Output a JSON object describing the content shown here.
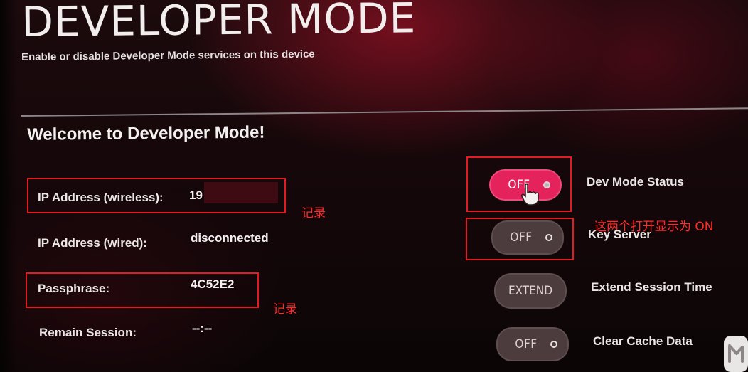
{
  "header": {
    "title": "DEVELOPER MODE",
    "subtitle": "Enable or disable Developer Mode services on this device"
  },
  "welcome": "Welcome to Developer Mode!",
  "info": {
    "ip_wireless": {
      "label": "IP Address (wireless):",
      "value": "19"
    },
    "ip_wired": {
      "label": "IP Address (wired):",
      "value": "disconnected"
    },
    "passphrase": {
      "label": "Passphrase:",
      "value": "4C52E2"
    },
    "remain_session": {
      "label": "Remain Session:",
      "value": "--:--"
    }
  },
  "toggles": {
    "dev_mode_status": {
      "label": "Dev Mode Status",
      "state": "OFF"
    },
    "key_server": {
      "label": "Key Server",
      "state": "OFF"
    },
    "extend_session": {
      "label": "Extend Session Time",
      "button": "EXTEND"
    },
    "clear_cache": {
      "label": "Clear Cache Data",
      "state": "OFF"
    }
  },
  "annotations": {
    "record_ip": "记录",
    "record_passphrase": "记录",
    "toggle_note": "这两个打开显示为 ON"
  },
  "colors": {
    "accent_pink": "#e4225c",
    "annotation_red": "#e21b23",
    "background": "#140709"
  },
  "icons": [
    "pointer-hand-icon",
    "watermark-logo-icon"
  ]
}
